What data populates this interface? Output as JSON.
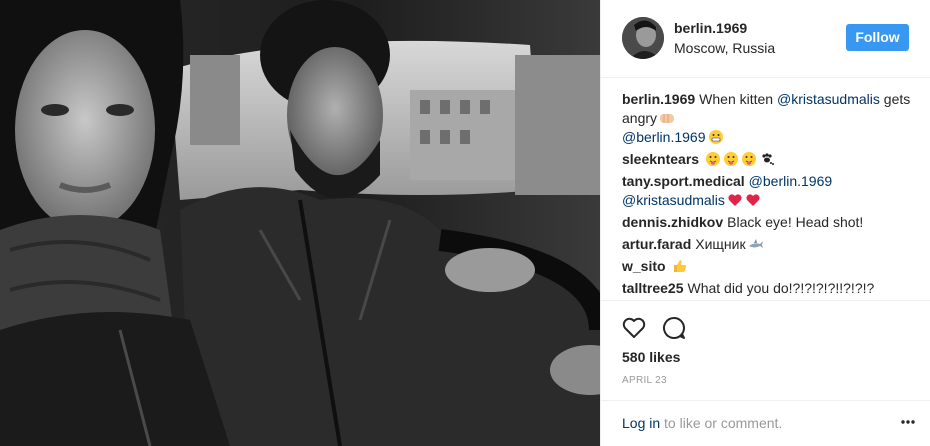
{
  "header": {
    "username": "berlin.1969",
    "location": "Moscow, Russia",
    "follow_label": "Follow"
  },
  "comments": [
    {
      "user": "berlin.1969",
      "text_before": "When kitten",
      "mention1": "@kristasudmalis",
      "text_mid": "gets angry",
      "emoji1": "fist-emoji",
      "mention2": "@berlin.1969",
      "emoji2": "grimace-emoji"
    },
    {
      "user": "sleekntears",
      "emojis": [
        "tongue-face-emoji",
        "tongue-face-emoji",
        "tongue-face-emoji",
        "paw-prints-emoji"
      ]
    },
    {
      "user": "tany.sport.medical",
      "mention1": "@berlin.1969",
      "mention2": "@kristasudmalis",
      "emojis": [
        "red-heart-emoji",
        "red-heart-emoji"
      ]
    },
    {
      "user": "dennis.zhidkov",
      "text": "Black eye! Head shot!"
    },
    {
      "user": "artur.farad",
      "text": "Хищник",
      "emoji": "shark-emoji"
    },
    {
      "user": "w_sito",
      "emoji": "thumbs-up-emoji"
    },
    {
      "user": "talltree25",
      "text": "What did you do!?!?!?!?!!?!?!?"
    }
  ],
  "actions": {
    "likes": "580 likes",
    "date": "APRIL 23"
  },
  "footer": {
    "login_link": "Log in",
    "login_rest": "to like or comment."
  },
  "colors": {
    "follow_bg": "#3897f0",
    "mention": "#003569",
    "muted": "#999999",
    "border": "#efefef"
  }
}
